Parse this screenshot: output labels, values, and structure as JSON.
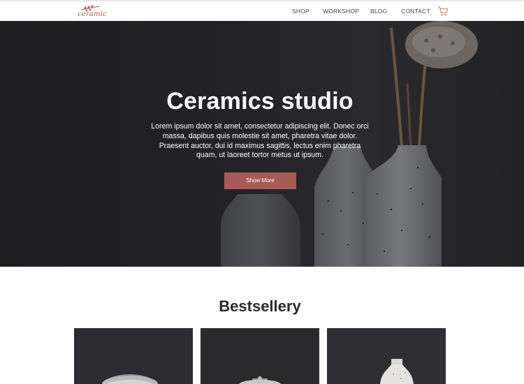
{
  "brand": {
    "name": "ceramic",
    "logo_icon": "leaf-branch-icon",
    "accent_color": "#a85a58"
  },
  "nav": {
    "items": [
      "SHOP",
      "WORKSHOP",
      "BLOG",
      "CONTACT"
    ],
    "cart_icon": "cart-icon"
  },
  "hero": {
    "title": "Ceramics studio",
    "body": "Lorem ipsum dolor sit amet, consectetur adipiscing elit. Donec orci massa, dapibus quis molestie sit amet, pharetra vitae dolor. Praesent auctor, dui id maximus sagittis, lectus enim pharetra quam, ut laoreet tortor metus ut ipsum.",
    "button_label": "Show More"
  },
  "bestsellers": {
    "title": "Bestsellery",
    "products": [
      {
        "image": "ceramic-bowl-image"
      },
      {
        "image": "ceramic-pot-image"
      },
      {
        "image": "ceramic-vase-image"
      }
    ]
  }
}
